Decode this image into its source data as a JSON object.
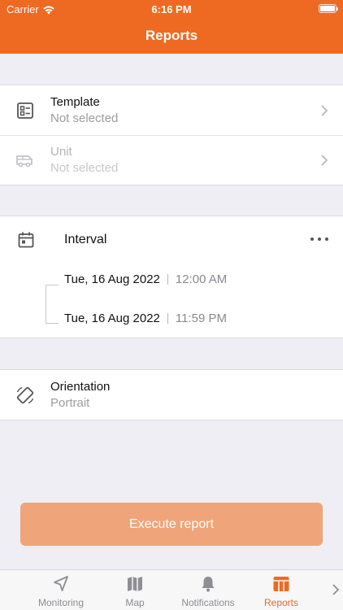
{
  "status": {
    "carrier": "Carrier",
    "time": "6:16 PM"
  },
  "header": {
    "title": "Reports"
  },
  "template": {
    "title": "Template",
    "value": "Not selected",
    "icon": "template-icon"
  },
  "unit": {
    "title": "Unit",
    "value": "Not selected",
    "icon": "van-icon",
    "enabled": false
  },
  "interval": {
    "title": "Interval",
    "icon": "calendar-icon",
    "start": {
      "date": "Tue, 16 Aug 2022",
      "time": "12:00 AM"
    },
    "end": {
      "date": "Tue, 16 Aug 2022",
      "time": "11:59 PM"
    }
  },
  "orientation": {
    "title": "Orientation",
    "value": "Portrait",
    "icon": "rotate-icon"
  },
  "execute": {
    "label": "Execute report",
    "enabled": false
  },
  "tabs": [
    {
      "label": "Monitoring",
      "icon": "navigation-arrow-icon",
      "active": false
    },
    {
      "label": "Map",
      "icon": "map-icon",
      "active": false
    },
    {
      "label": "Notifications",
      "icon": "bell-icon",
      "active": false
    },
    {
      "label": "Reports",
      "icon": "reports-table-icon",
      "active": true
    }
  ],
  "colors": {
    "accent": "#ee6a22",
    "accent_disabled": "#f0a479",
    "background": "#efeef4"
  }
}
